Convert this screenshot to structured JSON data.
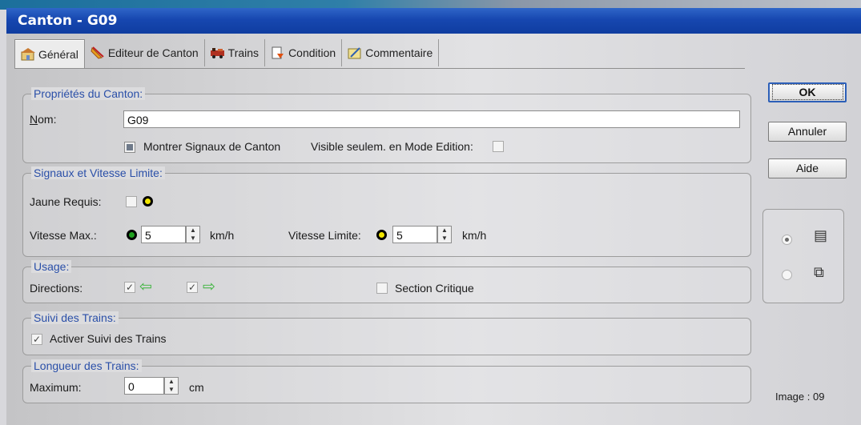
{
  "window": {
    "title": "Canton - G09"
  },
  "tabs": [
    {
      "label": "Général",
      "icon": "general-icon"
    },
    {
      "label": "Editeur de Canton",
      "icon": "editor-icon"
    },
    {
      "label": "Trains",
      "icon": "trains-icon"
    },
    {
      "label": "Condition",
      "icon": "condition-icon"
    },
    {
      "label": "Commentaire",
      "icon": "comment-icon"
    }
  ],
  "props": {
    "legend": "Propriétés du Canton:",
    "name_label": "Nom:",
    "name_value": "G09",
    "show_signals_label": "Montrer Signaux de Canton",
    "show_signals_checked": true,
    "visible_edit_label": "Visible seulem. en Mode Edition:",
    "visible_edit_checked": false
  },
  "signals": {
    "legend": "Signaux et Vitesse Limite:",
    "yellow_required_label": "Jaune Requis:",
    "yellow_required_checked": false,
    "max_speed_label": "Vitesse Max.:",
    "max_speed_value": "5",
    "max_speed_unit": "km/h",
    "limit_speed_label": "Vitesse Limite:",
    "limit_speed_value": "5",
    "limit_speed_unit": "km/h",
    "colors": {
      "green": "#1fa01f",
      "yellow": "#f2e600"
    }
  },
  "usage": {
    "legend": "Usage:",
    "directions_label": "Directions:",
    "dir_left_checked": true,
    "dir_right_checked": true,
    "critical_label": "Section Critique",
    "critical_checked": false
  },
  "tracking": {
    "legend": "Suivi des Trains:",
    "activate_label": "Activer Suivi des Trains",
    "activate_checked": true
  },
  "length": {
    "legend": "Longueur des Trains:",
    "max_label": "Maximum:",
    "max_value": "0",
    "unit": "cm"
  },
  "buttons": {
    "ok": "OK",
    "cancel": "Annuler",
    "help": "Aide"
  },
  "view": {
    "selected": "list"
  },
  "footer": {
    "image_label": "Image : 09"
  }
}
